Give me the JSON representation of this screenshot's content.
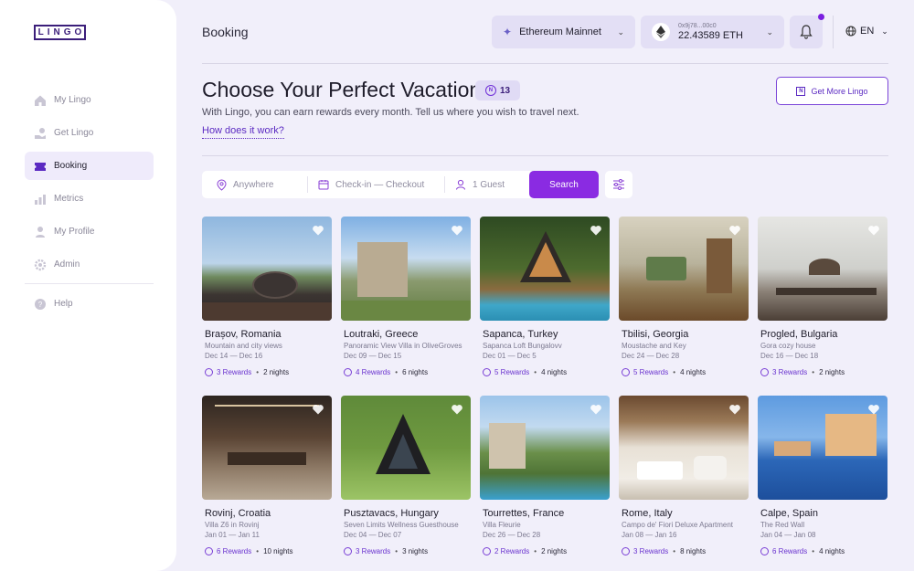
{
  "app": {
    "logo_text": "LINGO"
  },
  "sidebar": {
    "items": [
      {
        "label": "My Lingo",
        "icon": "home-icon"
      },
      {
        "label": "Get Lingo",
        "icon": "hand-coin-icon"
      },
      {
        "label": "Booking",
        "icon": "ticket-icon",
        "active": true
      },
      {
        "label": "Metrics",
        "icon": "bar-chart-icon"
      },
      {
        "label": "My Profile",
        "icon": "user-icon"
      },
      {
        "label": "Admin",
        "icon": "gear-icon"
      }
    ],
    "help_label": "Help"
  },
  "header": {
    "title": "Booking",
    "network": "Ethereum Mainnet",
    "wallet_address": "0x9j78...00c0",
    "wallet_balance": "22.43589 ETH",
    "language": "EN"
  },
  "hero": {
    "title": "Choose Your Perfect Vacation",
    "rewards_count": "13",
    "subtitle": "With Lingo, you can earn rewards every month. Tell us where you wish to travel next.",
    "how_link": "How does it work?",
    "get_more_label": "Get More Lingo"
  },
  "search": {
    "where_placeholder": "Anywhere",
    "dates_placeholder": "Check-in —  Checkout",
    "guests_placeholder": "1 Guest",
    "button_label": "Search"
  },
  "listings": [
    {
      "title": "Brașov, Romania",
      "subtitle": "Mountain and city views",
      "dates": "Dec 14 — Dec 16",
      "rewards": "3 Rewards",
      "nights": "2 nights"
    },
    {
      "title": "Loutraki, Greece",
      "subtitle": "Panoramic View Villa in OliveGroves",
      "dates": "Dec 09 — Dec 15",
      "rewards": "4 Rewards",
      "nights": "6 nights"
    },
    {
      "title": "Sapanca, Turkey",
      "subtitle": "Sapanca Loft Bungalovv",
      "dates": "Dec 01 — Dec 5",
      "rewards": "5 Rewards",
      "nights": "4 nights"
    },
    {
      "title": "Tbilisi, Georgia",
      "subtitle": "Moustache and Key",
      "dates": "Dec 24 — Dec 28",
      "rewards": "5 Rewards",
      "nights": "4 nights"
    },
    {
      "title": "Progled, Bulgaria",
      "subtitle": "Gora cozy house",
      "dates": "Dec 16 — Dec 18",
      "rewards": "3 Rewards",
      "nights": "2 nights"
    },
    {
      "title": "Rovinj, Croatia",
      "subtitle": "Villa Z6 in Rovinj",
      "dates": "Jan 01 — Jan 11",
      "rewards": "6 Rewards",
      "nights": "10 nights"
    },
    {
      "title": "Pusztavacs, Hungary",
      "subtitle": "Seven Limits Wellness Guesthouse",
      "dates": "Dec 04 — Dec 07",
      "rewards": "3 Rewards",
      "nights": "3 nights"
    },
    {
      "title": "Tourrettes, France",
      "subtitle": "Villa Fleurie",
      "dates": "Dec 26 — Dec 28",
      "rewards": "2 Rewards",
      "nights": "2 nights"
    },
    {
      "title": "Rome, Italy",
      "subtitle": "Campo de' Fiori Deluxe Apartment",
      "dates": "Jan 08 — Jan 16",
      "rewards": "3 Rewards",
      "nights": "8 nights"
    },
    {
      "title": "Calpe, Spain",
      "subtitle": "The Red Wall",
      "dates": "Jan 04 — Jan 08",
      "rewards": "6 Rewards",
      "nights": "4 nights"
    }
  ],
  "colors": {
    "accent": "#8a2be2",
    "background": "#f1effa",
    "chip": "#e3dff5"
  }
}
